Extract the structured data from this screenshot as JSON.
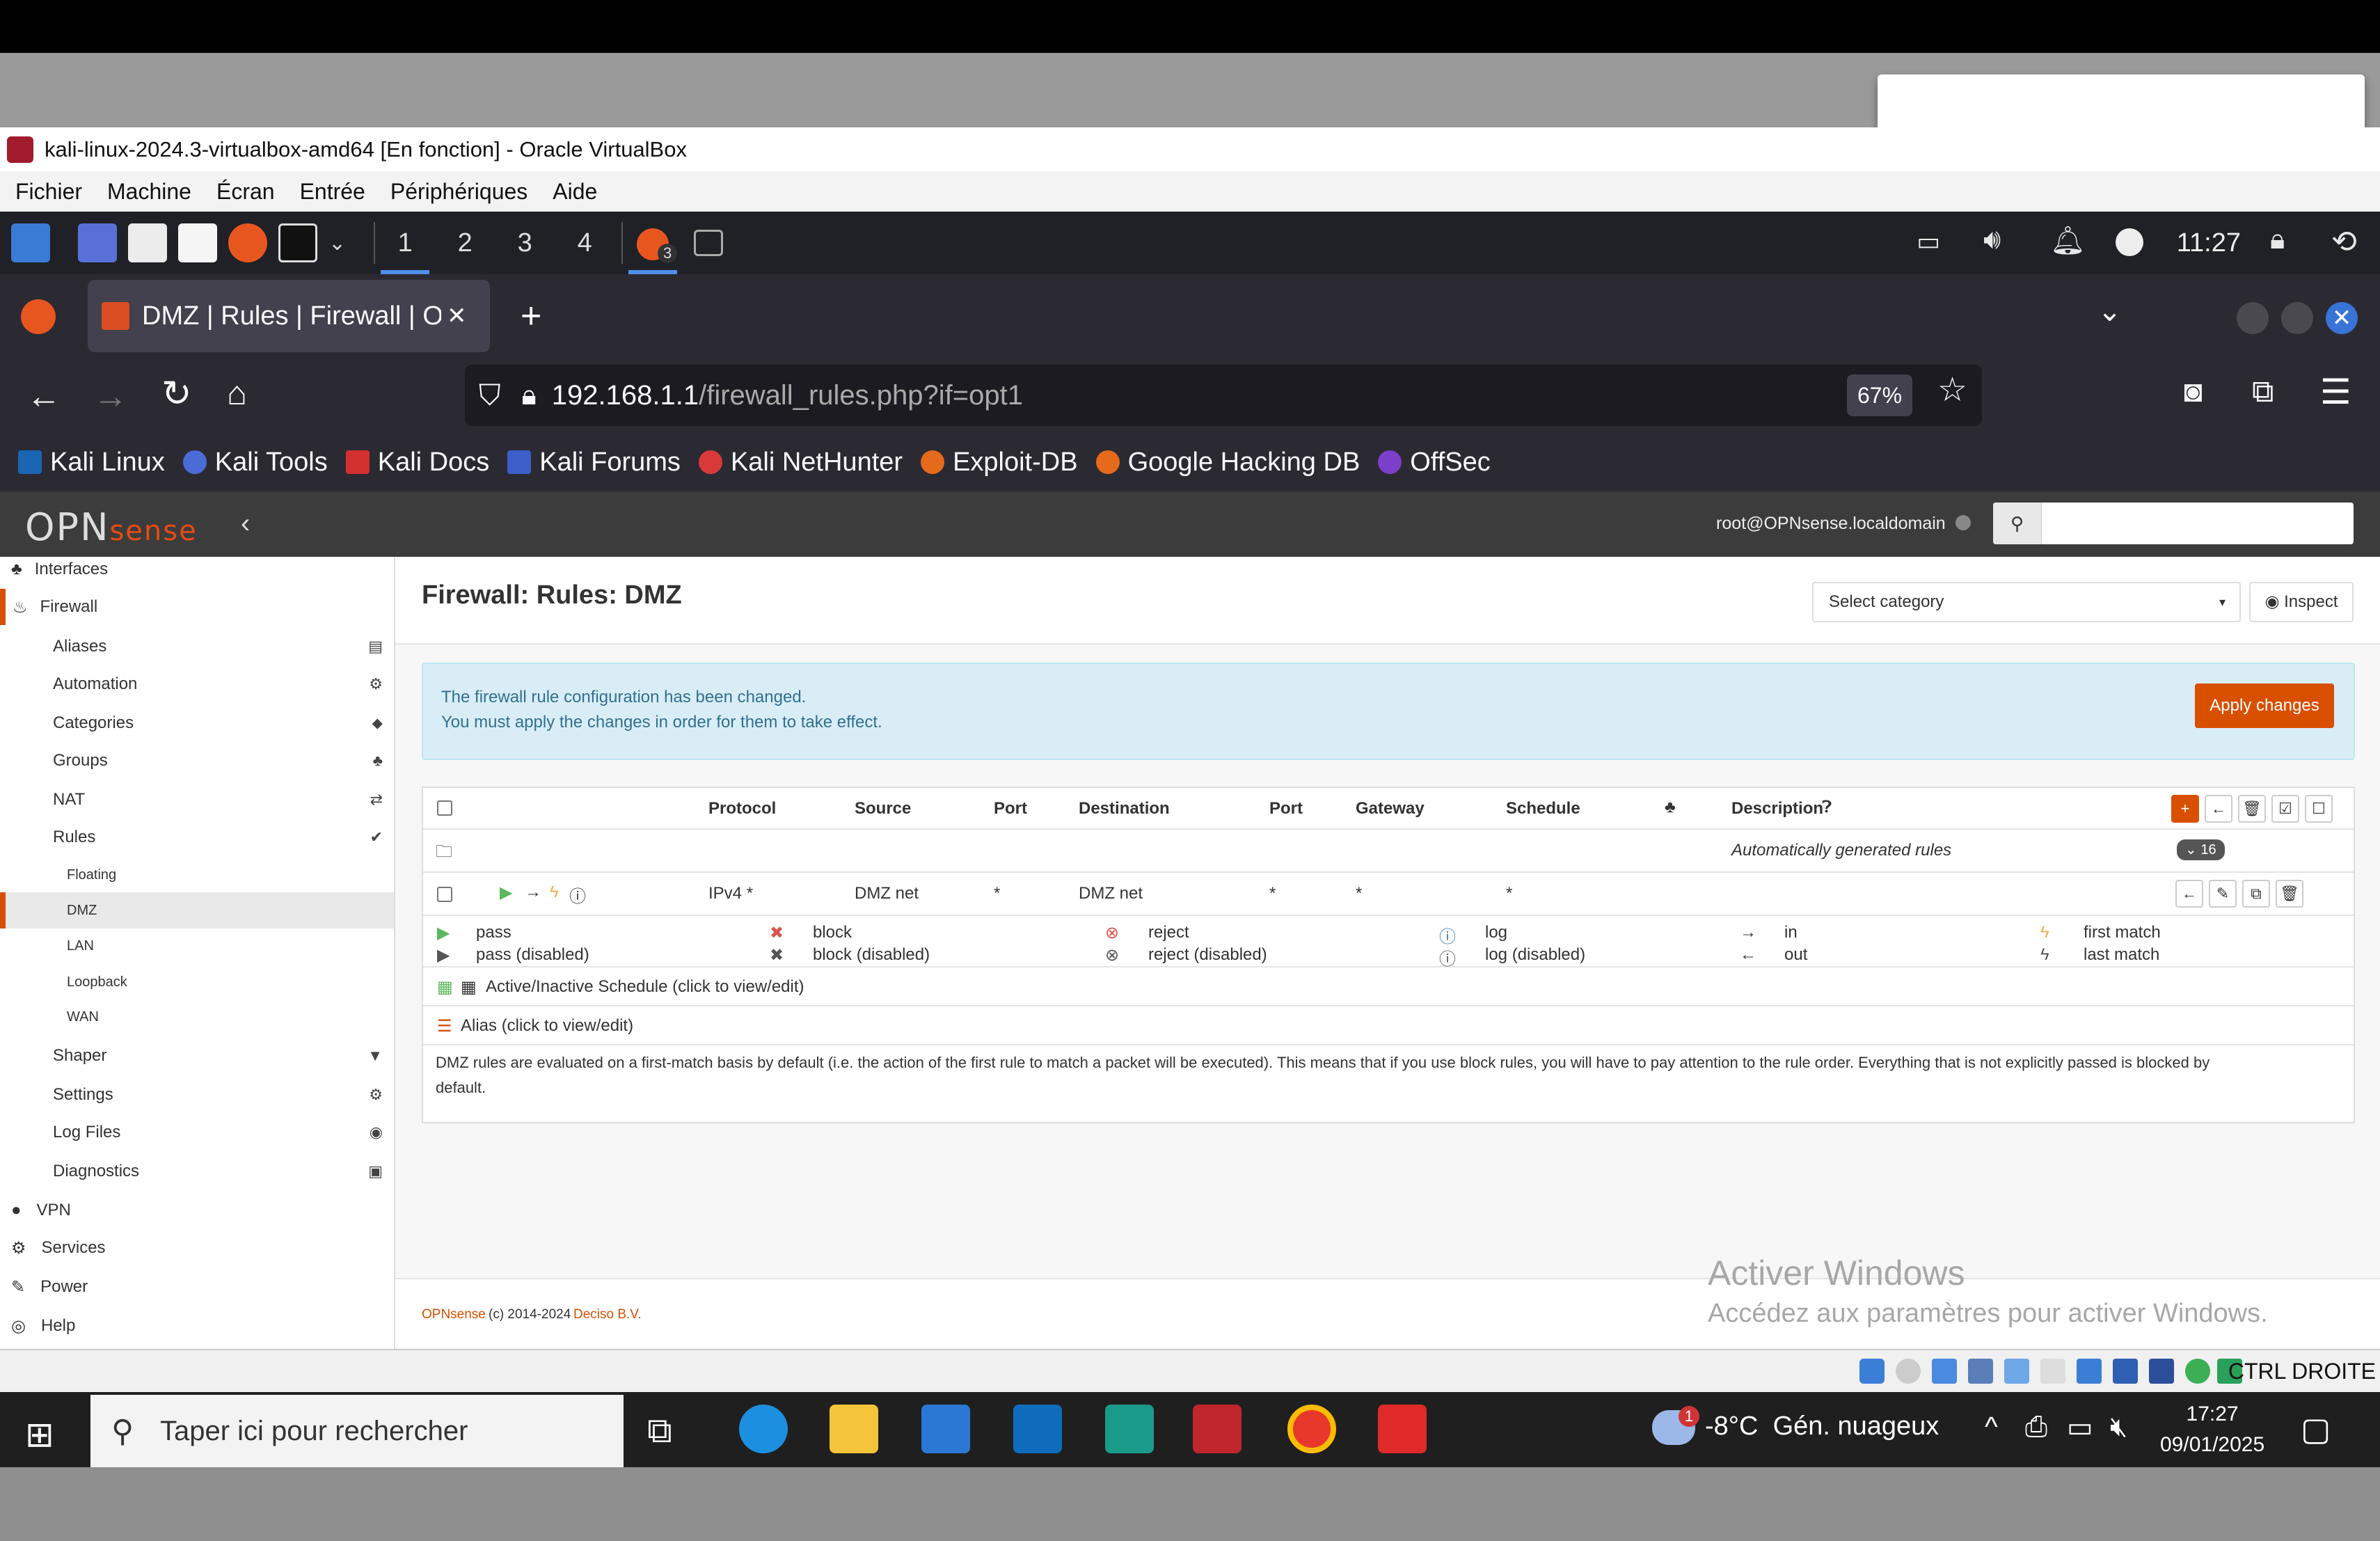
{
  "vbox": {
    "title": "kali-linux-2024.3-virtualbox-amd64 [En fonction] - Oracle VirtualBox",
    "menu": [
      "Fichier",
      "Machine",
      "Écran",
      "Entrée",
      "Périphériques",
      "Aide"
    ],
    "status_key": "CTRL DROITE"
  },
  "kali_panel": {
    "workspaces": [
      "1",
      "2",
      "3",
      "4"
    ],
    "firefox_badge": "3",
    "clock": "11:27"
  },
  "firefox": {
    "tab_title": "DMZ | Rules | Firewall | OPN",
    "new_tab": "+",
    "url_host": "192.168.1.1",
    "url_path": "/firewall_rules.php?if=opt1",
    "zoom": "67%",
    "bookmarks": [
      "Kali Linux",
      "Kali Tools",
      "Kali Docs",
      "Kali Forums",
      "Kali NetHunter",
      "Exploit-DB",
      "Google Hacking DB",
      "OffSec"
    ]
  },
  "opnsense": {
    "logo_main": "OPN",
    "logo_sub": "sense",
    "user": "root@OPNsense.localdomain",
    "sidebar": {
      "top": [
        "Interfaces",
        "Firewall"
      ],
      "firewall_items": [
        "Aliases",
        "Automation",
        "Categories",
        "Groups",
        "NAT",
        "Rules"
      ],
      "rules_sub": [
        "Floating",
        "DMZ",
        "LAN",
        "Loopback",
        "WAN"
      ],
      "firewall_items2": [
        "Shaper",
        "Settings",
        "Log Files",
        "Diagnostics"
      ],
      "bottom": [
        "VPN",
        "Services",
        "Power",
        "Help"
      ]
    },
    "page_title": "Firewall: Rules: DMZ",
    "category_select": "Select category",
    "inspect": "Inspect",
    "alert_line1": "The firewall rule configuration has been changed.",
    "alert_line2": "You must apply the changes in order for them to take effect.",
    "apply_changes": "Apply changes",
    "table": {
      "headers": [
        "Protocol",
        "Source",
        "Port",
        "Destination",
        "Port",
        "Gateway",
        "Schedule",
        "Description"
      ],
      "auto_rules_text": "Automatically generated rules",
      "auto_rules_count": "16",
      "rule": {
        "protocol": "IPv4 *",
        "source": "DMZ net",
        "port": "*",
        "destination": "DMZ net",
        "dport": "*",
        "gateway": "*",
        "schedule": "*"
      }
    },
    "legend": {
      "pass": "pass",
      "pass_disabled": "pass (disabled)",
      "block": "block",
      "block_disabled": "block (disabled)",
      "reject": "reject",
      "reject_disabled": "reject (disabled)",
      "log": "log",
      "log_disabled": "log (disabled)",
      "in": "in",
      "out": "out",
      "first_match": "first match",
      "last_match": "last match",
      "schedule": "Active/Inactive Schedule (click to view/edit)",
      "alias": "Alias (click to view/edit)",
      "note_line1": "DMZ rules are evaluated on a first-match basis by default (i.e. the action of the first rule to match a packet will be executed). This means that if you use block rules, you will have to pay attention to the rule order. Everything that is not explicitly passed is blocked by",
      "note_line2": "default."
    },
    "footer_brand": "OPNsense",
    "footer_copy": "(c) 2014-2024",
    "footer_company": "Deciso B.V."
  },
  "watermark": {
    "line1": "Activer Windows",
    "line2": "Accédez aux paramètres pour activer Windows."
  },
  "taskbar": {
    "search_placeholder": "Taper ici pour rechercher",
    "weather_temp": "-8°C",
    "weather_text": "Gén. nuageux",
    "weather_badge": "1",
    "time": "17:27",
    "date": "09/01/2025"
  },
  "colors": {
    "opn_orange": "#d94f00",
    "alert_bg": "#d9edf7",
    "pass_green": "#5cb85c",
    "block_red": "#d9534f"
  }
}
